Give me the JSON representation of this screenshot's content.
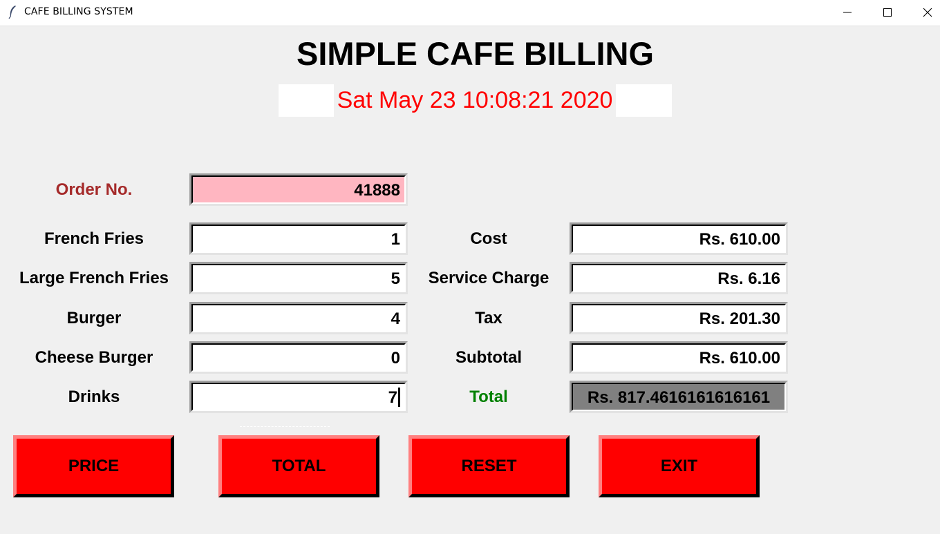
{
  "window": {
    "title": "CAFE BILLING SYSTEM",
    "icon": "feather-icon"
  },
  "header": {
    "title": "SIMPLE CAFE BILLING",
    "datetime": "Sat May 23 10:08:21 2020"
  },
  "order": {
    "label": "Order No.",
    "value": "41888"
  },
  "items": [
    {
      "label": "French Fries",
      "qty": "1"
    },
    {
      "label": "Large French Fries",
      "qty": "5"
    },
    {
      "label": "Burger",
      "qty": "4"
    },
    {
      "label": "Cheese Burger",
      "qty": "0"
    },
    {
      "label": "Drinks",
      "qty": "7"
    }
  ],
  "summary": {
    "cost": {
      "label": "Cost",
      "value": "Rs. 610.00"
    },
    "service_charge": {
      "label": "Service Charge",
      "value": "Rs. 6.16"
    },
    "tax": {
      "label": "Tax",
      "value": "Rs. 201.30"
    },
    "subtotal": {
      "label": "Subtotal",
      "value": "Rs. 610.00"
    },
    "total": {
      "label": "Total",
      "value": "Rs. 817.4616161616161"
    }
  },
  "buttons": {
    "price": "PRICE",
    "total": "TOTAL",
    "reset": "RESET",
    "exit": "EXIT"
  },
  "colors": {
    "window_bg": "#f0f0f0",
    "date_text": "#ff0000",
    "order_label": "#a52a2a",
    "order_entry_bg": "#ffb6c1",
    "total_label": "#008000",
    "total_entry_bg": "#808080",
    "button_bg": "#ff0000"
  }
}
